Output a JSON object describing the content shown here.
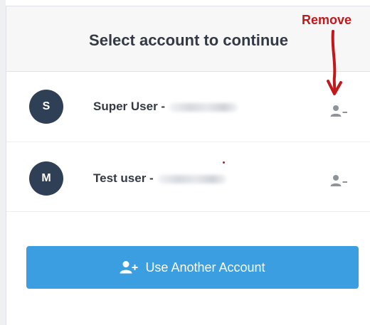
{
  "dialog": {
    "title": "Select account to continue"
  },
  "accounts": [
    {
      "initial": "S",
      "name_prefix": "Super User -",
      "remove_icon": "user-minus-icon"
    },
    {
      "initial": "M",
      "name_prefix": "Test user -",
      "remove_icon": "user-minus-icon"
    }
  ],
  "primary_action": {
    "label": "Use Another Account",
    "icon": "user-plus-icon",
    "color": "#3a9ee0"
  },
  "annotation": {
    "label": "Remove",
    "color": "#c0181b"
  },
  "colors": {
    "avatar": "#2f3f55",
    "header_bg": "#f7f7f7",
    "text": "#333a44"
  }
}
